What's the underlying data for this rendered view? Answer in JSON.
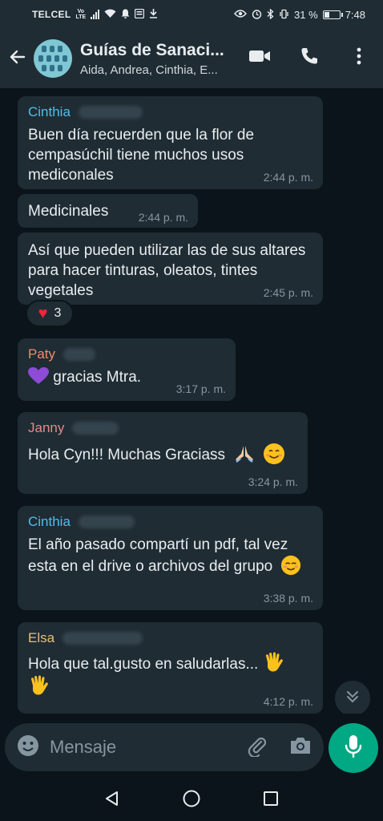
{
  "status": {
    "carrier": "TELCEL",
    "volte_top": "Vo",
    "volte_bottom": "LTE",
    "battery": "31 %",
    "clock": "7:48"
  },
  "header": {
    "title": "Guías de Sanaci...",
    "subtitle": "Aida, Andrea, Cinthia, E..."
  },
  "colors": {
    "background": "#0b141a",
    "bubble": "#1f2c34",
    "accent": "#00a884",
    "cinthia": "#53bdeb",
    "paty": "#f28c6b",
    "janny": "#e38b8b",
    "elsa": "#e5c07b"
  },
  "messages": [
    {
      "sender": "Cinthia",
      "text": "Buen día recuerden que la flor de cempasúchil tiene muchos usos mediconales",
      "time": "2:44 p. m."
    },
    {
      "sender": "",
      "text": "Medicinales",
      "time": "2:44 p. m."
    },
    {
      "sender": "",
      "text": "Así que pueden utilizar las de sus altares para hacer tinturas, oleatos, tintes vegetales",
      "time": "2:45 p. m.",
      "reaction_count": "3"
    },
    {
      "sender": "Paty",
      "text": "gracias Mtra.",
      "time": "3:17 p. m."
    },
    {
      "sender": "Janny",
      "text": "Hola Cyn!!! Muchas Graciass",
      "time": "3:24 p. m."
    },
    {
      "sender": "Cinthia",
      "text": "El año pasado compartí un pdf, tal vez esta en el drive o archivos del grupo",
      "time": "3:38 p. m."
    },
    {
      "sender": "Elsa",
      "text": "Hola que tal.gusto en saludarlas...",
      "time": "4:12 p. m."
    }
  ],
  "input": {
    "placeholder": "Mensaje"
  },
  "icons": [
    "back-arrow-icon",
    "video-call-icon",
    "phone-icon",
    "more-icon",
    "emoji-icon",
    "attach-icon",
    "camera-icon",
    "mic-icon",
    "scroll-down-icon",
    "nav-back-icon",
    "nav-home-icon",
    "nav-recents-icon"
  ]
}
